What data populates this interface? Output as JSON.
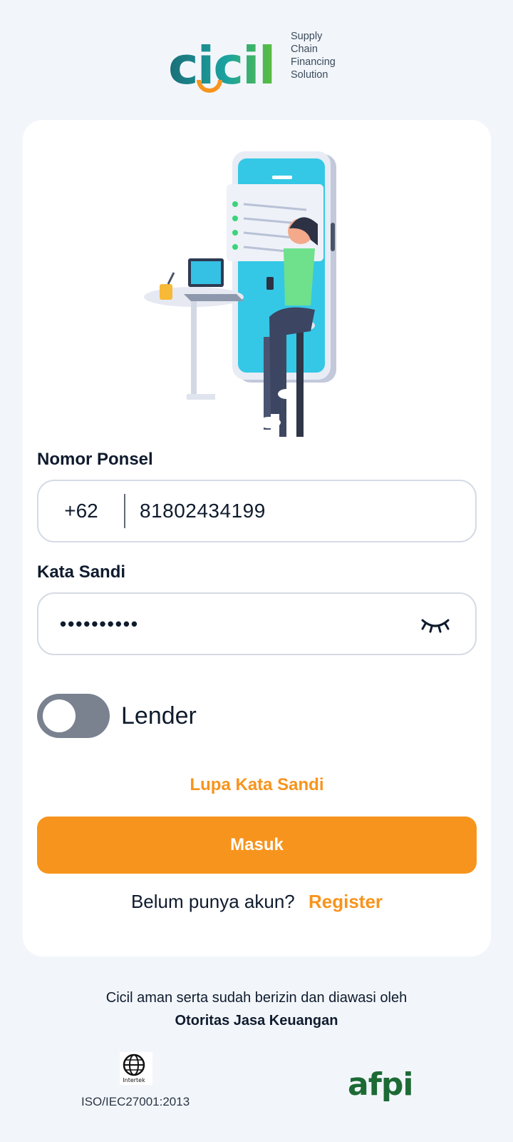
{
  "brand": {
    "logo_text": "cicil",
    "tagline": [
      "Supply",
      "Chain",
      "Financing",
      "Solution"
    ]
  },
  "login": {
    "phone_label": "Nomor Ponsel",
    "phone_prefix": "+62",
    "phone_value": "81802434199",
    "password_label": "Kata Sandi",
    "password_value": "••••••••••",
    "lender_toggle_label": "Lender",
    "lender_toggle_on": false,
    "forgot_password": "Lupa Kata Sandi",
    "submit_label": "Masuk",
    "no_account_text": "Belum punya akun?",
    "register_link": "Register"
  },
  "footer": {
    "licensed_text": "Cicil aman serta sudah berizin dan diawasi oleh",
    "regulator": "Otoritas Jasa Keuangan",
    "iso_brand": "Intertek",
    "iso_label": "ISO/IEC27001:2013",
    "partner_logo": "afpi"
  },
  "colors": {
    "accent": "#f7941d",
    "background": "#f2f6fb",
    "toggle_off": "#7a8290",
    "afpi_green": "#1d6a35"
  }
}
